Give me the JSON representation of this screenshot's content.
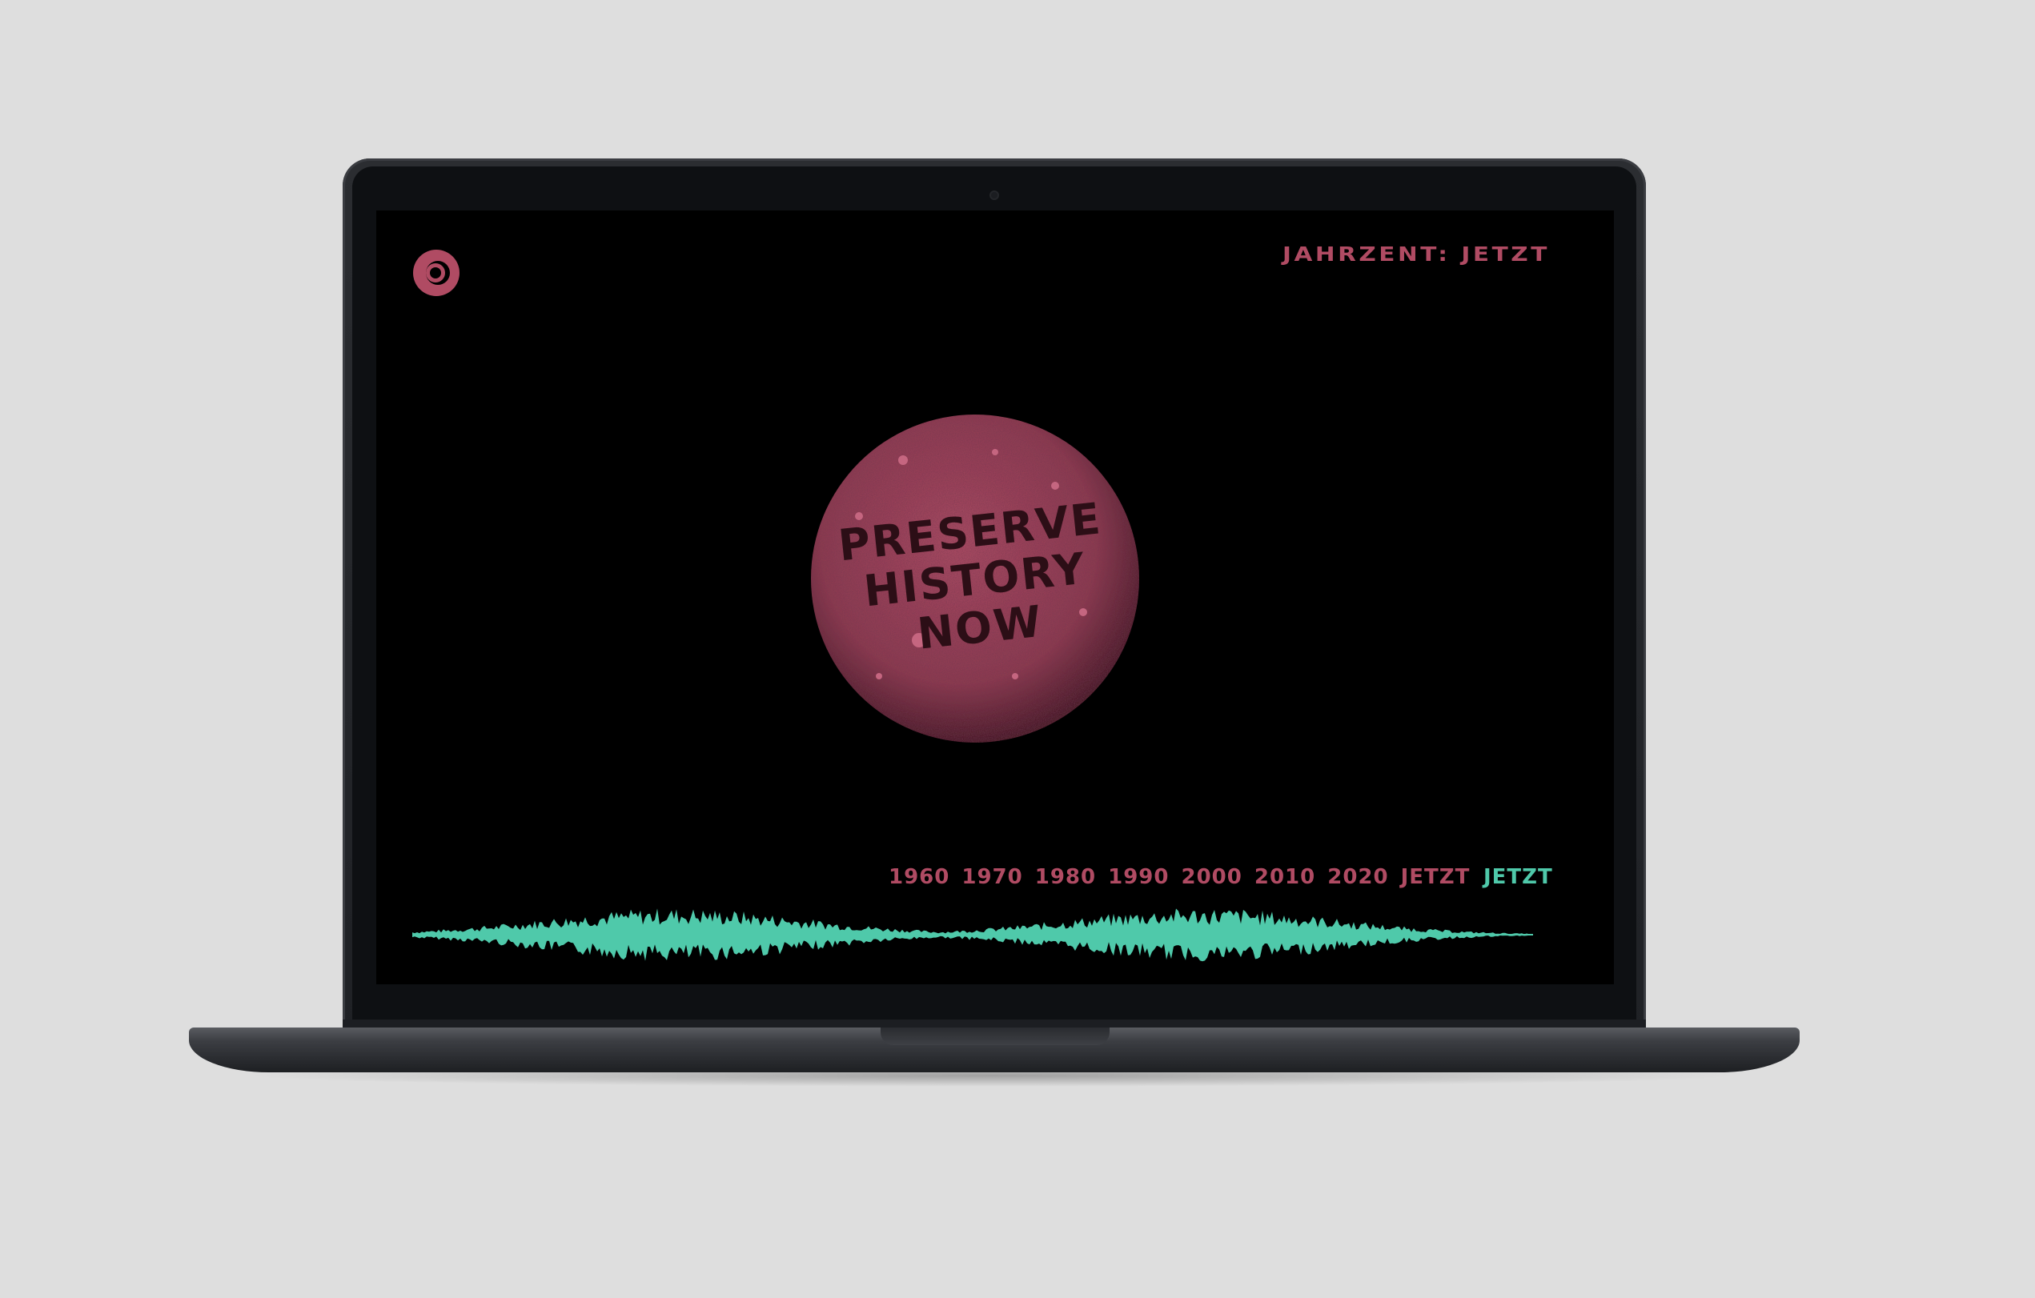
{
  "header": {
    "decade_label": "JAHRZENT: JETZT"
  },
  "hero": {
    "pill_text_line1": "PRESERVE",
    "pill_text_line2": "HISTORY",
    "pill_text_line3": "NOW"
  },
  "timeline": {
    "years": [
      "1960",
      "1970",
      "1980",
      "1990",
      "2000",
      "2010",
      "2020"
    ],
    "overlap_label": "JETZT",
    "active_label": "JETZT"
  },
  "colors": {
    "accent_pink": "#b04b63",
    "accent_teal": "#4fc9aa",
    "screen_bg": "#000000"
  },
  "icons": {
    "logo": "record-disc-icon"
  }
}
